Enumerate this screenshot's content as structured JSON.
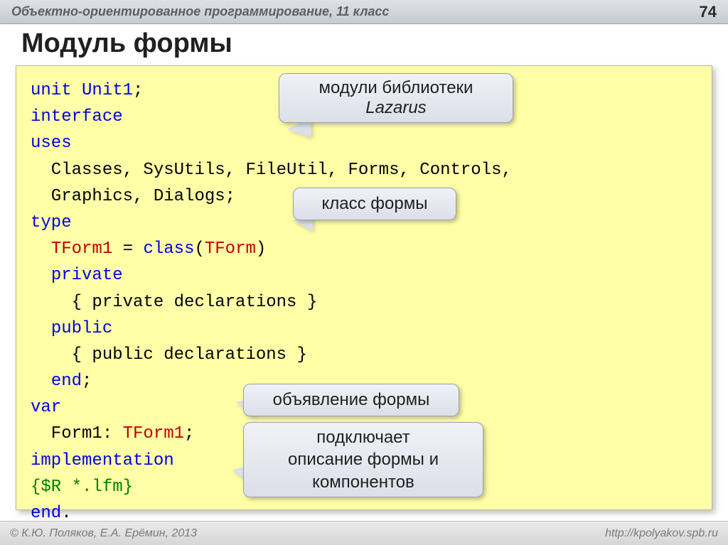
{
  "header": {
    "title": "Объектно-ориентированное программирование, 11 класс",
    "page_number": "74"
  },
  "slide_title": "Модуль формы",
  "code": {
    "l1_kw": "unit ",
    "l1_id": "Unit1",
    "l1_sc": ";",
    "l2": "interface",
    "l3": "uses",
    "l4": "  Classes, SysUtils, FileUtil, Forms, Controls,",
    "l5": "  Graphics, Dialogs;",
    "l6": "type",
    "l7_a": "  ",
    "l7_b": "TForm1",
    "l7_c": " = ",
    "l7_d": "class",
    "l7_e": "(",
    "l7_f": "TForm",
    "l7_g": ")",
    "l8_a": "  ",
    "l8_b": "private",
    "l9": "    { private declarations }",
    "l10_a": "  ",
    "l10_b": "public",
    "l11": "    { public declarations }",
    "l12_a": "  ",
    "l12_b": "end",
    "l12_c": ";",
    "l13": "var",
    "l14_a": "  Form1: ",
    "l14_b": "TForm1",
    "l14_c": ";",
    "l15": "implementation",
    "l16": "{$R *.lfm}",
    "l17_a": "end",
    "l17_b": "."
  },
  "callouts": {
    "c1_line1": "модули библиотеки",
    "c1_line2": "Lazarus",
    "c2": "класс формы",
    "c3": "объявление формы",
    "c4_line1": "подключает",
    "c4_line2": "описание формы и",
    "c4_line3": "компонентов"
  },
  "footer": {
    "left": "© К.Ю. Поляков, Е.А. Ерёмин, 2013",
    "right": "http://kpolyakov.spb.ru"
  }
}
